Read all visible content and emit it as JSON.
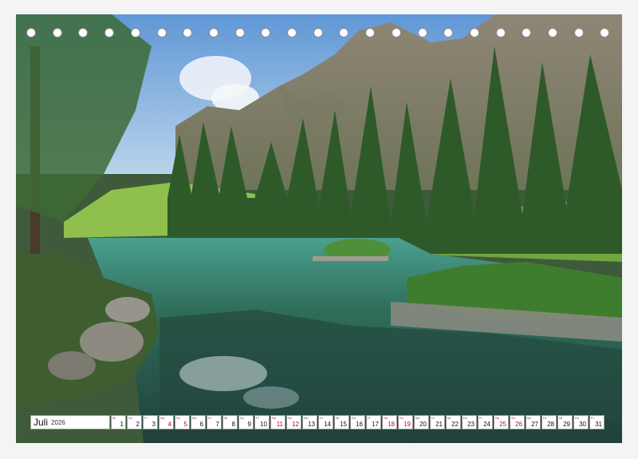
{
  "calendar": {
    "month": "Juli",
    "year": "2026",
    "days": [
      {
        "num": "1",
        "wd": "Mi",
        "red": false
      },
      {
        "num": "2",
        "wd": "Do",
        "red": false
      },
      {
        "num": "3",
        "wd": "Fr",
        "red": false
      },
      {
        "num": "4",
        "wd": "Sa",
        "red": true
      },
      {
        "num": "5",
        "wd": "So",
        "red": true
      },
      {
        "num": "6",
        "wd": "Mo",
        "red": false
      },
      {
        "num": "7",
        "wd": "Di",
        "red": false
      },
      {
        "num": "8",
        "wd": "Mi",
        "red": false
      },
      {
        "num": "9",
        "wd": "Do",
        "red": false
      },
      {
        "num": "10",
        "wd": "Fr",
        "red": false
      },
      {
        "num": "11",
        "wd": "Sa",
        "red": true
      },
      {
        "num": "12",
        "wd": "So",
        "red": true
      },
      {
        "num": "13",
        "wd": "Mo",
        "red": false
      },
      {
        "num": "14",
        "wd": "Di",
        "red": false
      },
      {
        "num": "15",
        "wd": "Mi",
        "red": false
      },
      {
        "num": "16",
        "wd": "Do",
        "red": false
      },
      {
        "num": "17",
        "wd": "Fr",
        "red": false
      },
      {
        "num": "18",
        "wd": "Sa",
        "red": true
      },
      {
        "num": "19",
        "wd": "So",
        "red": true
      },
      {
        "num": "20",
        "wd": "Mo",
        "red": false
      },
      {
        "num": "21",
        "wd": "Di",
        "red": false
      },
      {
        "num": "22",
        "wd": "Mi",
        "red": false
      },
      {
        "num": "23",
        "wd": "Do",
        "red": false
      },
      {
        "num": "24",
        "wd": "Fr",
        "red": false
      },
      {
        "num": "25",
        "wd": "Sa",
        "red": true
      },
      {
        "num": "26",
        "wd": "So",
        "red": true
      },
      {
        "num": "27",
        "wd": "Mo",
        "red": false
      },
      {
        "num": "28",
        "wd": "Di",
        "red": false
      },
      {
        "num": "29",
        "wd": "Mi",
        "red": false
      },
      {
        "num": "30",
        "wd": "Do",
        "red": false
      },
      {
        "num": "31",
        "wd": "Fr",
        "red": false
      }
    ]
  },
  "binding": {
    "hole_count": 23
  },
  "colors": {
    "weekend": "#b01818",
    "sky": "#7fb2e0",
    "lake": "#3f8f86"
  }
}
